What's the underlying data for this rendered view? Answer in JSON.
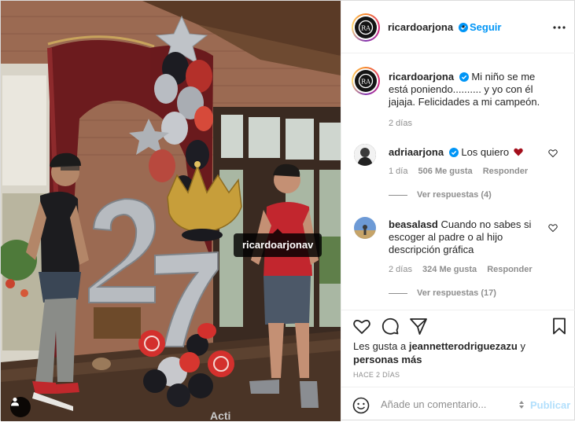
{
  "tag": {
    "username": "ricardoarjonav"
  },
  "header": {
    "username": "ricardoarjona",
    "separator": "•",
    "follow_label": "Seguir"
  },
  "caption": {
    "username": "ricardoarjona",
    "text": "Mi niño se me está poniendo.......... y yo con él jajaja. Felicidades a mi campeón.",
    "time": "2 días"
  },
  "comments": [
    {
      "username": "adriaarjona",
      "text": "Los quiero",
      "has_heart_emoji": true,
      "time": "1 día",
      "likes": "506 Me gusta",
      "reply_label": "Responder",
      "view_replies": "Ver respuestas (4)"
    },
    {
      "username": "beasalasd",
      "text": "Cuando no sabes si escoger al padre o al hijo descripción gráfica",
      "time": "2 días",
      "likes": "324 Me gusta",
      "reply_label": "Responder",
      "view_replies": "Ver respuestas (17)"
    }
  ],
  "likes_line": {
    "prefix": "Les gusta a",
    "user": "jeannetterodriguezazu",
    "connector": "y",
    "others": "personas más"
  },
  "post_time": "HACE 2 DÍAS",
  "add_comment": {
    "placeholder": "Añade un comentario...",
    "publish_label": "Publicar"
  },
  "overlay_text": "Acti",
  "colors": {
    "accent": "#0095f6",
    "publish_disabled": "#b2dffc",
    "heart": "#a30e1b",
    "secondary_text": "#8e8e8e"
  },
  "icons": [
    "profile-logo-icon",
    "verified-badge-icon",
    "more-options-icon",
    "small-heart-icon",
    "like-heart-icon",
    "comment-icon",
    "share-icon",
    "save-icon",
    "emoji-icon",
    "user-tag-icon"
  ]
}
